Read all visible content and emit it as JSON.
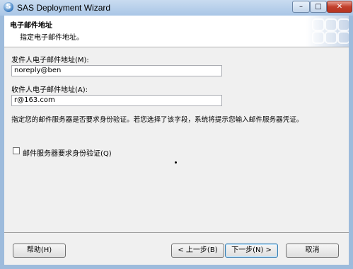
{
  "window": {
    "title": "SAS Deployment Wizard",
    "app_icon_glyph": "S",
    "minimize_glyph": "–",
    "maximize_glyph": "□",
    "close_glyph": "✕"
  },
  "header": {
    "title": "电子邮件地址",
    "subtitle": "指定电子邮件地址。"
  },
  "form": {
    "sender_label": "发件人电子邮件地址(M):",
    "sender_value": "noreply@ben",
    "recipient_label": "收件人电子邮件地址(A):",
    "recipient_value": "r@163.com",
    "description": "指定您的邮件服务器是否要求身份验证。若您选择了该字段，系统将提示您输入邮件服务器凭证。",
    "auth_checkbox_label": "邮件服务器要求身份验证(Q)",
    "auth_checkbox_checked": false
  },
  "buttons": {
    "help": "帮助(H)",
    "back": "< 上一步(B)",
    "next": "下一步(N) >",
    "cancel": "取消"
  },
  "colors": {
    "frame": "#9dbbdc",
    "panel": "#f0f0f0",
    "close_button": "#c2402d"
  }
}
